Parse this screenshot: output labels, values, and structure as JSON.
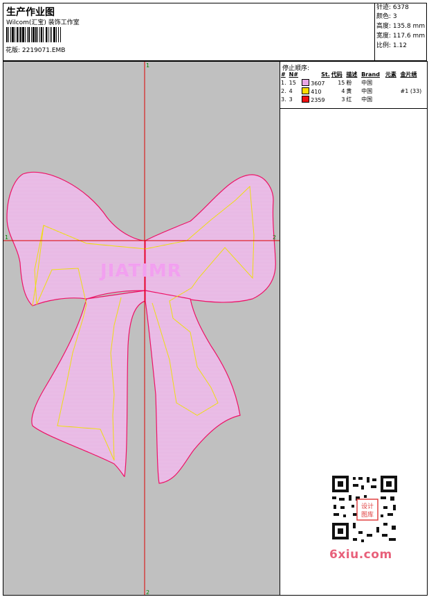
{
  "header": {
    "title": "生产作业图",
    "subtitle": "Wilcom(汇宝) 装饰工作室",
    "design_label": "花版: 2219071.EMB"
  },
  "stats": [
    {
      "label": "针迹:",
      "value": "6378"
    },
    {
      "label": "颜色:",
      "value": "3"
    },
    {
      "label": "高度:",
      "value": "135.8 mm"
    },
    {
      "label": "宽度:",
      "value": "117.6 mm"
    },
    {
      "label": "比例:",
      "value": "1.12"
    }
  ],
  "stop_sequence": {
    "title": "停止顺序:",
    "columns": [
      "#",
      "N#",
      "St.",
      "代码",
      "描述",
      "Brand",
      "元素",
      "金片绣"
    ],
    "rows": [
      {
        "index": "1.",
        "n": "15",
        "color": "#e9a6e6",
        "st": "3607",
        "code": "15",
        "desc": "粉",
        "brand": "中国",
        "element": "",
        "sequin": ""
      },
      {
        "index": "2.",
        "n": "4",
        "color": "#ffdd00",
        "st": "410",
        "code": "4",
        "desc": "黄",
        "brand": "中国",
        "element": "",
        "sequin": "#1 (33)"
      },
      {
        "index": "3.",
        "n": "3",
        "color": "#ee1111",
        "st": "2359",
        "code": "3",
        "desc": "红",
        "brand": "中国",
        "element": "",
        "sequin": ""
      }
    ]
  },
  "canvas": {
    "text": "JIATIMR",
    "markers": [
      "1",
      "2",
      "1",
      "2"
    ],
    "colors": {
      "background": "#c0c0c0",
      "fill": "#e6b3e2",
      "outline": "#ee1166",
      "guide": "#dd0000",
      "run": "#eedd11",
      "text": "#f2a0f0"
    }
  },
  "watermark": {
    "site": "6xiu.com",
    "seal": "设计图库"
  }
}
